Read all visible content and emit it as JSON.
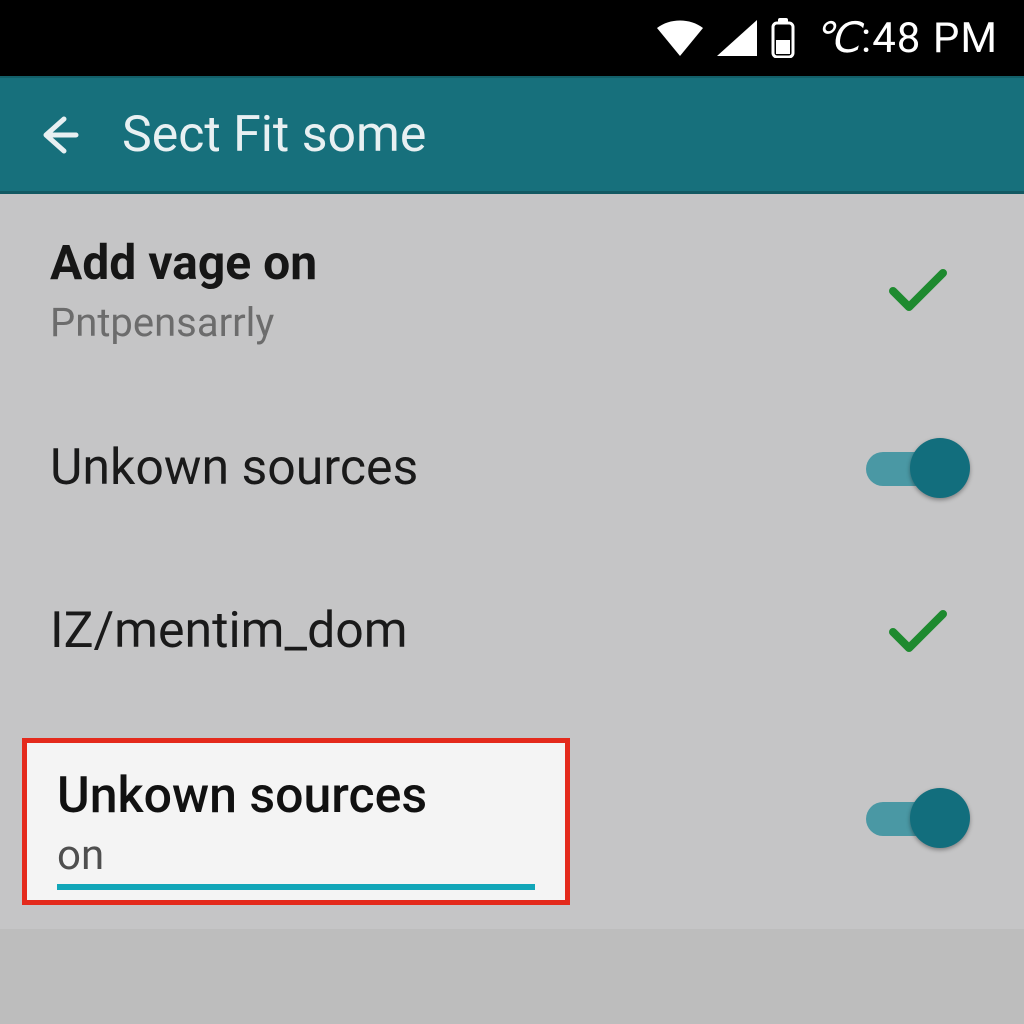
{
  "status_bar": {
    "clock": ":48 PM",
    "clock_prefix_glyph": "℃"
  },
  "app_bar": {
    "title": "Sect Fit some"
  },
  "rows": [
    {
      "title": "Add vage on",
      "subtitle": "Pntpensarrly",
      "control": "check"
    },
    {
      "title": "Unkown sources",
      "subtitle": "",
      "control": "switch"
    },
    {
      "title": "IZ/mentim_dom",
      "subtitle": "",
      "control": "check"
    },
    {
      "title": "Unkown sources",
      "subtitle": "on",
      "control": "switch",
      "highlighted": true
    }
  ],
  "colors": {
    "accent": "#126e7d",
    "appbar": "#17707c",
    "check": "#1e8a2f",
    "danger": "#e42a1c",
    "teal_line": "#11a6b8"
  }
}
